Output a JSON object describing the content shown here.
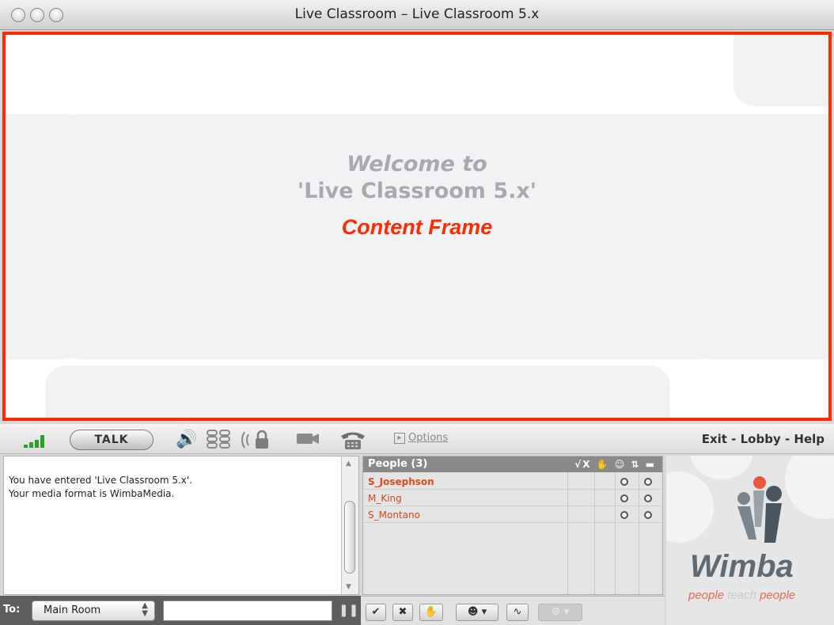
{
  "window": {
    "title": "Live Classroom – Live Classroom 5.x"
  },
  "content_frame": {
    "welcome_line1": "Welcome to",
    "welcome_line2": "'Live Classroom 5.x'",
    "frame_label": "Content Frame"
  },
  "toolbar": {
    "talk_label": "TALK",
    "options_label": "Options",
    "links": "Exit - Lobby - Help",
    "icons": [
      "signal-strength-icon",
      "speaker-volume-icon",
      "hand-raise-icon",
      "video-camera-icon",
      "telephone-icon"
    ]
  },
  "chat": {
    "lines": [
      "You have entered 'Live Classroom 5.x'.",
      "Your media format is WimbaMedia."
    ],
    "to_label": "To:",
    "room": "Main Room"
  },
  "people": {
    "header": "People (3)",
    "header_icons": "√X ✋ ☺ ⇅ ▬",
    "members": [
      {
        "name": "S_Josephson",
        "bold": true
      },
      {
        "name": "M_King",
        "bold": false
      },
      {
        "name": "S_Montano",
        "bold": false
      }
    ]
  },
  "logo": {
    "brand": "Wimba",
    "tagline_a": "people ",
    "tagline_b": "teach ",
    "tagline_c": "people"
  },
  "colors": {
    "accent": "#ff2a00",
    "brand_grey": "#606a72",
    "name_red": "#d24a1a"
  }
}
